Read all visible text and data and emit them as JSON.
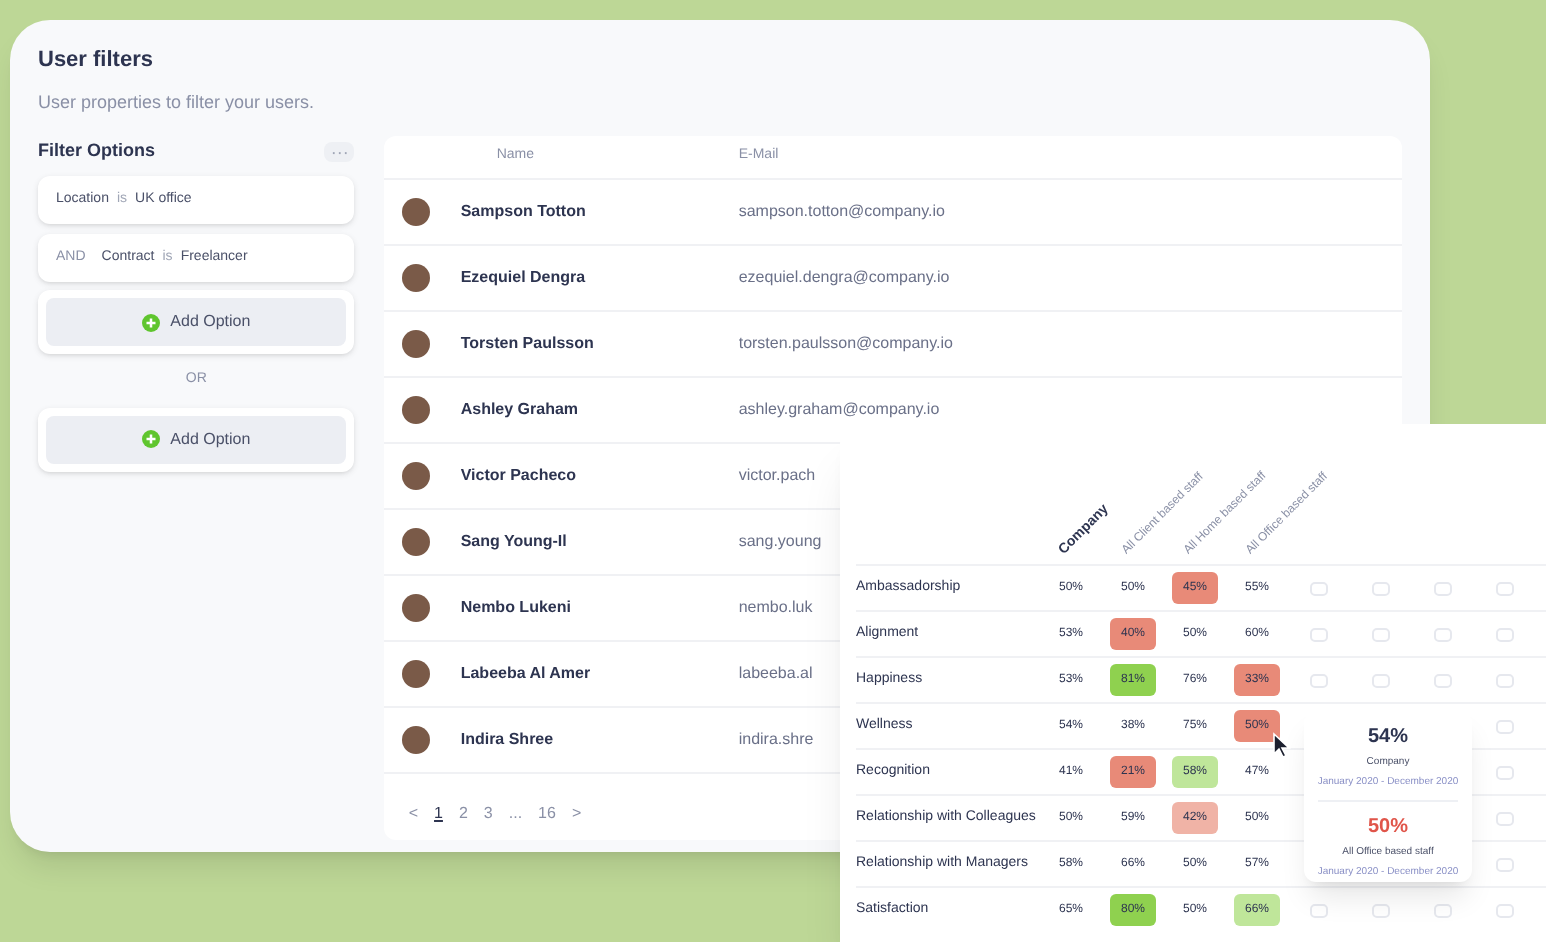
{
  "panel": {
    "title": "User filters",
    "subtitle": "User properties to filter your users."
  },
  "filters": {
    "title": "Filter Options",
    "menu": "···",
    "conditions": [
      {
        "field": "Location",
        "operator": "is",
        "value": "UK office"
      },
      {
        "connector": "AND",
        "field": "Contract",
        "operator": "is",
        "value": "Freelancer"
      }
    ],
    "add_label": "Add Option",
    "separator": "OR",
    "add_label_2": "Add Option"
  },
  "table": {
    "columns": [
      "Name",
      "E-Mail"
    ],
    "rows": [
      {
        "name": "Sampson Totton",
        "email": "sampson.totton@company.io"
      },
      {
        "name": "Ezequiel Dengra",
        "email": "ezequiel.dengra@company.io"
      },
      {
        "name": "Torsten Paulsson",
        "email": "torsten.paulsson@company.io"
      },
      {
        "name": "Ashley Graham",
        "email": "ashley.graham@company.io"
      },
      {
        "name": "Victor Pacheco",
        "email": "victor.pach"
      },
      {
        "name": "Sang Young-Il",
        "email": "sang.young"
      },
      {
        "name": "Nembo Lukeni",
        "email": "nembo.luk"
      },
      {
        "name": "Labeeba Al Amer",
        "email": "labeeba.al"
      },
      {
        "name": "Indira Shree",
        "email": "indira.shre"
      }
    ],
    "pagination": [
      {
        "label": "<",
        "selected": false
      },
      {
        "label": "1",
        "selected": true
      },
      {
        "label": "2",
        "selected": false
      },
      {
        "label": "3",
        "selected": false
      },
      {
        "label": "...",
        "selected": false
      },
      {
        "label": "16",
        "selected": false
      },
      {
        "label": ">",
        "selected": false
      }
    ]
  },
  "heatmap": {
    "columns": [
      "Company",
      "All Client based staff",
      "All Home based staff",
      "All Office based staff"
    ],
    "rows": [
      {
        "label": "Ambassadorship",
        "cells": [
          {
            "value": "50%"
          },
          {
            "value": "50%"
          },
          {
            "value": "45%",
            "color": "#e88a78"
          },
          {
            "value": "55%"
          }
        ]
      },
      {
        "label": "Alignment",
        "cells": [
          {
            "value": "53%"
          },
          {
            "value": "40%",
            "color": "#e88a78"
          },
          {
            "value": "50%"
          },
          {
            "value": "60%"
          }
        ]
      },
      {
        "label": "Happiness",
        "cells": [
          {
            "value": "53%"
          },
          {
            "value": "81%",
            "color": "#8fd14f"
          },
          {
            "value": "76%"
          },
          {
            "value": "33%",
            "color": "#e88a78"
          }
        ]
      },
      {
        "label": "Wellness",
        "cells": [
          {
            "value": "54%"
          },
          {
            "value": "38%"
          },
          {
            "value": "75%"
          },
          {
            "value": "50%",
            "color": "#e88a78"
          }
        ]
      },
      {
        "label": "Recognition",
        "cells": [
          {
            "value": "41%"
          },
          {
            "value": "21%",
            "color": "#e88a78"
          },
          {
            "value": "58%",
            "color": "#bfe69a"
          },
          {
            "value": "47%"
          }
        ]
      },
      {
        "label": "Relationship with Colleagues",
        "cells": [
          {
            "value": "50%"
          },
          {
            "value": "59%"
          },
          {
            "value": "42%",
            "color": "#f0b3a6"
          },
          {
            "value": "50%"
          }
        ]
      },
      {
        "label": "Relationship with Managers",
        "cells": [
          {
            "value": "58%"
          },
          {
            "value": "66%"
          },
          {
            "value": "50%"
          },
          {
            "value": "57%"
          }
        ]
      },
      {
        "label": "Satisfaction",
        "cells": [
          {
            "value": "65%"
          },
          {
            "value": "80%",
            "color": "#8fd14f"
          },
          {
            "value": "50%"
          },
          {
            "value": "66%",
            "color": "#bfe69a"
          }
        ]
      }
    ]
  },
  "tooltip": [
    {
      "value": "54%",
      "label": "Company",
      "period": "January 2020 - December 2020",
      "highlight": false
    },
    {
      "value": "50%",
      "label": "All Office based staff",
      "period": "January 2020 - December 2020",
      "highlight": true
    }
  ]
}
